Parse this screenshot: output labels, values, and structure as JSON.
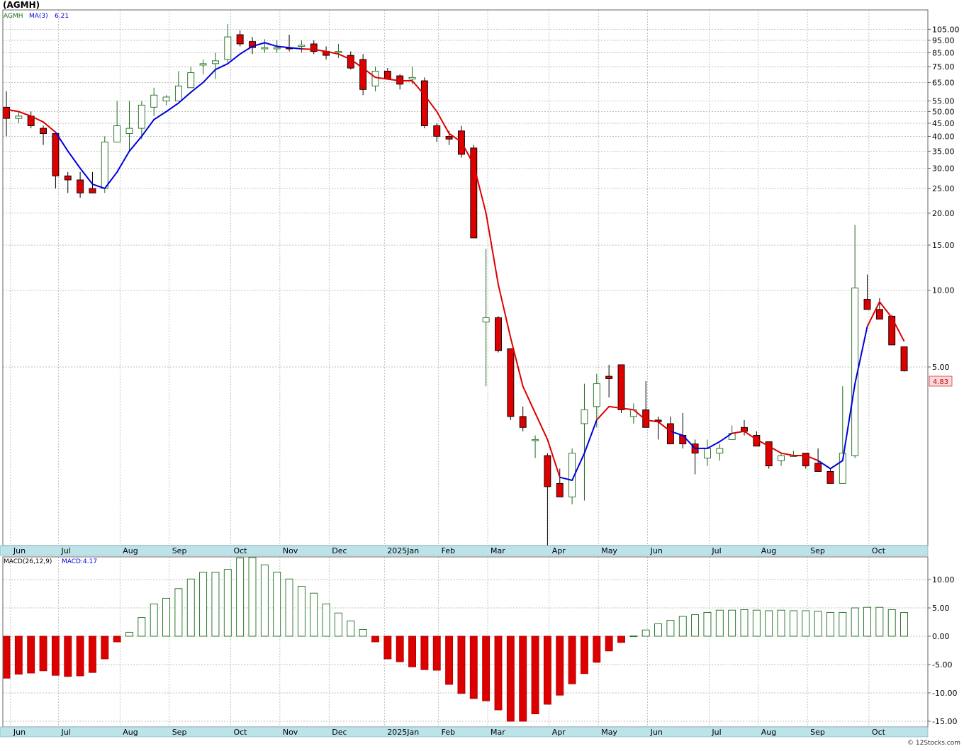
{
  "title": "(AGMH)",
  "footer": "© 12Stocks.com",
  "colors": {
    "up": "#1a6b1a",
    "down": "#dd0000",
    "ma_above": "#0000dd",
    "ma_below": "#dd0000",
    "grid": "#aaaaaa",
    "axis_band": "#bde3ea",
    "price_flag_bg": "#fadadd",
    "price_flag_fg": "#cc0000"
  },
  "chart_data": [
    {
      "type": "candlestick",
      "title": "(AGMH)",
      "legend": [
        "AGMH",
        "MA(3)",
        "6.21"
      ],
      "scale": "log",
      "ylim": [
        1.0,
        125
      ],
      "yticks": [
        "105.00",
        "95.00",
        "85.00",
        "75.00",
        "65.00",
        "55.00",
        "50.00",
        "45.00",
        "40.00",
        "35.00",
        "30.00",
        "25.00",
        "20.00",
        "15.00",
        "10.00",
        "5.00"
      ],
      "last_price_label": "4.83",
      "x_labels": [
        {
          "bar": 0.8,
          "label": "Jun"
        },
        {
          "bar": 4.7,
          "label": "Jul"
        },
        {
          "bar": 9.7,
          "label": "Aug"
        },
        {
          "bar": 13.7,
          "label": "Sep"
        },
        {
          "bar": 18.7,
          "label": "Oct"
        },
        {
          "bar": 22.7,
          "label": "Nov"
        },
        {
          "bar": 26.7,
          "label": "Dec"
        },
        {
          "bar": 31.2,
          "label": "2025Jan"
        },
        {
          "bar": 35.6,
          "label": "Feb"
        },
        {
          "bar": 39.6,
          "label": "Mar"
        },
        {
          "bar": 44.6,
          "label": "Apr"
        },
        {
          "bar": 48.6,
          "label": "May"
        },
        {
          "bar": 52.6,
          "label": "Jun"
        },
        {
          "bar": 57.6,
          "label": "Jul"
        },
        {
          "bar": 61.6,
          "label": "Aug"
        },
        {
          "bar": 65.6,
          "label": "Sep"
        },
        {
          "bar": 70.6,
          "label": "Oct"
        }
      ],
      "ohlc": [
        [
          52,
          60,
          40,
          47
        ],
        [
          47,
          50,
          45,
          48
        ],
        [
          48,
          50,
          43,
          44
        ],
        [
          43,
          44,
          37,
          41
        ],
        [
          41,
          41,
          25,
          28
        ],
        [
          28,
          29,
          24,
          27
        ],
        [
          27,
          29,
          23,
          24
        ],
        [
          25,
          29,
          24,
          24
        ],
        [
          25,
          40,
          24,
          38
        ],
        [
          38,
          55,
          38,
          44
        ],
        [
          41,
          55,
          35,
          43
        ],
        [
          43,
          55,
          39,
          53
        ],
        [
          52,
          62,
          48,
          58
        ],
        [
          55,
          58,
          53,
          57
        ],
        [
          55,
          72,
          55,
          63
        ],
        [
          62,
          75,
          62,
          71
        ],
        [
          76,
          80,
          70,
          77
        ],
        [
          77,
          85,
          67,
          79
        ],
        [
          80,
          110,
          78,
          98
        ],
        [
          100,
          104,
          90,
          92
        ],
        [
          94,
          98,
          84,
          89
        ],
        [
          88,
          96,
          85,
          89
        ],
        [
          88,
          95,
          85,
          89
        ],
        [
          89,
          100,
          86,
          88
        ],
        [
          90,
          95,
          85,
          91
        ],
        [
          92,
          95,
          84,
          86
        ],
        [
          86,
          90,
          80,
          83
        ],
        [
          85,
          92,
          81,
          86
        ],
        [
          83,
          86,
          73,
          74
        ],
        [
          80,
          84,
          58,
          61
        ],
        [
          63,
          75,
          60,
          72
        ],
        [
          72,
          74,
          67,
          67
        ],
        [
          69,
          70,
          61,
          64
        ],
        [
          67,
          75,
          64,
          68
        ],
        [
          66,
          68,
          43,
          44
        ],
        [
          44,
          45,
          38,
          40
        ],
        [
          40,
          42,
          37,
          39
        ],
        [
          42,
          44,
          33,
          34
        ],
        [
          36,
          37,
          16,
          16
        ],
        [
          7.5,
          14.5,
          4.2,
          7.8
        ],
        [
          7.8,
          7.9,
          5.7,
          5.8
        ],
        [
          5.9,
          5.9,
          3.1,
          3.2
        ],
        [
          3.2,
          3.5,
          2.8,
          2.9
        ],
        [
          2.6,
          2.7,
          2.2,
          2.6
        ],
        [
          2.25,
          2.3,
          1.0,
          1.7
        ],
        [
          1.75,
          2.0,
          1.55,
          1.55
        ],
        [
          1.55,
          2.4,
          1.45,
          2.3
        ],
        [
          3.0,
          4.3,
          1.5,
          3.4
        ],
        [
          3.5,
          4.7,
          2.9,
          4.3
        ],
        [
          4.6,
          5.1,
          3.8,
          4.5
        ],
        [
          5.1,
          5.1,
          3.3,
          3.4
        ],
        [
          3.2,
          3.6,
          3.0,
          3.4
        ],
        [
          3.4,
          4.4,
          2.9,
          2.9
        ],
        [
          3.1,
          3.2,
          2.6,
          3.05
        ],
        [
          3.0,
          3.2,
          2.7,
          2.5
        ],
        [
          2.7,
          3.3,
          2.4,
          2.5
        ],
        [
          2.5,
          2.6,
          1.9,
          2.3
        ],
        [
          2.2,
          2.6,
          2.05,
          2.4
        ],
        [
          2.3,
          2.5,
          2.15,
          2.4
        ],
        [
          2.6,
          2.95,
          2.6,
          2.75
        ],
        [
          2.9,
          3.1,
          2.7,
          2.8
        ],
        [
          2.7,
          2.8,
          2.55,
          2.45
        ],
        [
          2.55,
          2.5,
          2.0,
          2.05
        ],
        [
          2.15,
          2.3,
          2.05,
          2.25
        ],
        [
          2.25,
          2.35,
          2.25,
          2.25
        ],
        [
          2.3,
          2.25,
          2.0,
          2.05
        ],
        [
          2.1,
          2.4,
          2.0,
          1.95
        ],
        [
          1.95,
          2.0,
          1.75,
          1.75
        ],
        [
          1.75,
          4.2,
          1.75,
          2.3
        ],
        [
          2.25,
          18,
          2.2,
          10.2
        ],
        [
          9.2,
          11.5,
          8.5,
          8.4
        ],
        [
          8.4,
          9.3,
          7.8,
          7.7
        ],
        [
          7.9,
          8.0,
          6.1,
          6.1
        ],
        [
          6.0,
          6.0,
          4.8,
          4.83
        ]
      ],
      "ma3": [
        51,
        50,
        48,
        45.5,
        41.5,
        35,
        30,
        26,
        25,
        29,
        35,
        40,
        46.5,
        50,
        54,
        59.5,
        65,
        73,
        77,
        84,
        90,
        93,
        90,
        89,
        88,
        87.5,
        86,
        84,
        80,
        74,
        68,
        67,
        66,
        66,
        58,
        50,
        41,
        38,
        31,
        20,
        10.5,
        6.5,
        4.2,
        3.3,
        2.6,
        1.85,
        1.8,
        2.3,
        3.1,
        3.5,
        3.45,
        3.4,
        3.1,
        3.05,
        2.8,
        2.7,
        2.4,
        2.4,
        2.55,
        2.75,
        2.8,
        2.6,
        2.45,
        2.3,
        2.25,
        2.25,
        2.15,
        2.0,
        2.15,
        4.3,
        7.2,
        9.0,
        7.8,
        6.3
      ],
      "ma_color_switch": [
        [
          "red",
          0,
          4
        ],
        [
          "blue",
          5,
          8
        ],
        [
          "blue",
          9,
          17
        ],
        [
          "blue",
          18,
          24
        ],
        [
          "red",
          25,
          45
        ],
        [
          "blue",
          46,
          48
        ],
        [
          "red",
          49,
          54
        ],
        [
          "blue",
          55,
          59
        ],
        [
          "red",
          60,
          66
        ],
        [
          "blue",
          67,
          70
        ],
        [
          "red",
          71,
          73
        ]
      ]
    },
    {
      "type": "bar",
      "title": "MACD(26,12,9)",
      "legend": [
        "MACD(26,12,9)",
        "MACD:4.17"
      ],
      "ylim": [
        -16,
        14
      ],
      "yticks": [
        "10.00",
        "5.00",
        "0.00",
        "-5.00",
        "-10.00",
        "-15.00"
      ],
      "values": [
        -7.4,
        -6.7,
        -6.5,
        -6.1,
        -6.9,
        -7.1,
        -7.0,
        -6.4,
        -4.0,
        -1.0,
        0.7,
        3.3,
        5.7,
        6.7,
        8.4,
        10.1,
        11.3,
        11.3,
        11.8,
        13.8,
        13.9,
        12.6,
        11.3,
        10.1,
        8.8,
        7.6,
        5.7,
        4.1,
        2.7,
        1.2,
        -1.0,
        -4.0,
        -4.5,
        -5.4,
        -5.9,
        -6.0,
        -8.5,
        -10.1,
        -11.0,
        -11.4,
        -13.0,
        -15.0,
        -15.0,
        -13.7,
        -12.0,
        -10.4,
        -8.4,
        -6.6,
        -4.6,
        -2.6,
        -1.1,
        0.05,
        1.1,
        2.2,
        2.8,
        3.5,
        3.8,
        4.2,
        4.6,
        4.6,
        4.7,
        4.6,
        4.5,
        4.6,
        4.5,
        4.5,
        4.4,
        4.2,
        4.2,
        5.0,
        5.1,
        5.1,
        4.7,
        4.17
      ]
    }
  ]
}
